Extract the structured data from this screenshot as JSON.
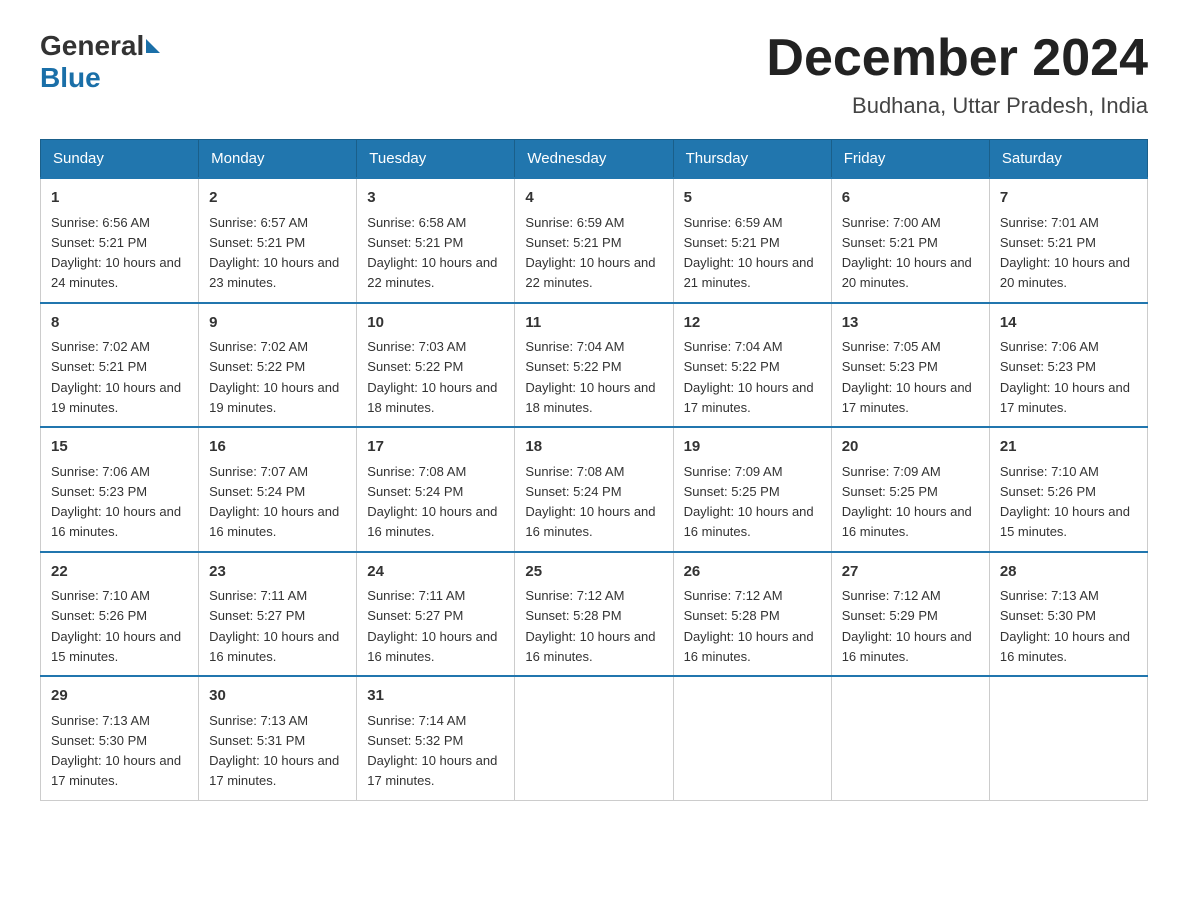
{
  "header": {
    "logo_general": "General",
    "logo_blue": "Blue",
    "month_title": "December 2024",
    "location": "Budhana, Uttar Pradesh, India"
  },
  "days_of_week": [
    "Sunday",
    "Monday",
    "Tuesday",
    "Wednesday",
    "Thursday",
    "Friday",
    "Saturday"
  ],
  "weeks": [
    [
      {
        "day": "1",
        "sunrise": "6:56 AM",
        "sunset": "5:21 PM",
        "daylight": "10 hours and 24 minutes."
      },
      {
        "day": "2",
        "sunrise": "6:57 AM",
        "sunset": "5:21 PM",
        "daylight": "10 hours and 23 minutes."
      },
      {
        "day": "3",
        "sunrise": "6:58 AM",
        "sunset": "5:21 PM",
        "daylight": "10 hours and 22 minutes."
      },
      {
        "day": "4",
        "sunrise": "6:59 AM",
        "sunset": "5:21 PM",
        "daylight": "10 hours and 22 minutes."
      },
      {
        "day": "5",
        "sunrise": "6:59 AM",
        "sunset": "5:21 PM",
        "daylight": "10 hours and 21 minutes."
      },
      {
        "day": "6",
        "sunrise": "7:00 AM",
        "sunset": "5:21 PM",
        "daylight": "10 hours and 20 minutes."
      },
      {
        "day": "7",
        "sunrise": "7:01 AM",
        "sunset": "5:21 PM",
        "daylight": "10 hours and 20 minutes."
      }
    ],
    [
      {
        "day": "8",
        "sunrise": "7:02 AM",
        "sunset": "5:21 PM",
        "daylight": "10 hours and 19 minutes."
      },
      {
        "day": "9",
        "sunrise": "7:02 AM",
        "sunset": "5:22 PM",
        "daylight": "10 hours and 19 minutes."
      },
      {
        "day": "10",
        "sunrise": "7:03 AM",
        "sunset": "5:22 PM",
        "daylight": "10 hours and 18 minutes."
      },
      {
        "day": "11",
        "sunrise": "7:04 AM",
        "sunset": "5:22 PM",
        "daylight": "10 hours and 18 minutes."
      },
      {
        "day": "12",
        "sunrise": "7:04 AM",
        "sunset": "5:22 PM",
        "daylight": "10 hours and 17 minutes."
      },
      {
        "day": "13",
        "sunrise": "7:05 AM",
        "sunset": "5:23 PM",
        "daylight": "10 hours and 17 minutes."
      },
      {
        "day": "14",
        "sunrise": "7:06 AM",
        "sunset": "5:23 PM",
        "daylight": "10 hours and 17 minutes."
      }
    ],
    [
      {
        "day": "15",
        "sunrise": "7:06 AM",
        "sunset": "5:23 PM",
        "daylight": "10 hours and 16 minutes."
      },
      {
        "day": "16",
        "sunrise": "7:07 AM",
        "sunset": "5:24 PM",
        "daylight": "10 hours and 16 minutes."
      },
      {
        "day": "17",
        "sunrise": "7:08 AM",
        "sunset": "5:24 PM",
        "daylight": "10 hours and 16 minutes."
      },
      {
        "day": "18",
        "sunrise": "7:08 AM",
        "sunset": "5:24 PM",
        "daylight": "10 hours and 16 minutes."
      },
      {
        "day": "19",
        "sunrise": "7:09 AM",
        "sunset": "5:25 PM",
        "daylight": "10 hours and 16 minutes."
      },
      {
        "day": "20",
        "sunrise": "7:09 AM",
        "sunset": "5:25 PM",
        "daylight": "10 hours and 16 minutes."
      },
      {
        "day": "21",
        "sunrise": "7:10 AM",
        "sunset": "5:26 PM",
        "daylight": "10 hours and 15 minutes."
      }
    ],
    [
      {
        "day": "22",
        "sunrise": "7:10 AM",
        "sunset": "5:26 PM",
        "daylight": "10 hours and 15 minutes."
      },
      {
        "day": "23",
        "sunrise": "7:11 AM",
        "sunset": "5:27 PM",
        "daylight": "10 hours and 16 minutes."
      },
      {
        "day": "24",
        "sunrise": "7:11 AM",
        "sunset": "5:27 PM",
        "daylight": "10 hours and 16 minutes."
      },
      {
        "day": "25",
        "sunrise": "7:12 AM",
        "sunset": "5:28 PM",
        "daylight": "10 hours and 16 minutes."
      },
      {
        "day": "26",
        "sunrise": "7:12 AM",
        "sunset": "5:28 PM",
        "daylight": "10 hours and 16 minutes."
      },
      {
        "day": "27",
        "sunrise": "7:12 AM",
        "sunset": "5:29 PM",
        "daylight": "10 hours and 16 minutes."
      },
      {
        "day": "28",
        "sunrise": "7:13 AM",
        "sunset": "5:30 PM",
        "daylight": "10 hours and 16 minutes."
      }
    ],
    [
      {
        "day": "29",
        "sunrise": "7:13 AM",
        "sunset": "5:30 PM",
        "daylight": "10 hours and 17 minutes."
      },
      {
        "day": "30",
        "sunrise": "7:13 AM",
        "sunset": "5:31 PM",
        "daylight": "10 hours and 17 minutes."
      },
      {
        "day": "31",
        "sunrise": "7:14 AM",
        "sunset": "5:32 PM",
        "daylight": "10 hours and 17 minutes."
      },
      null,
      null,
      null,
      null
    ]
  ],
  "labels": {
    "sunrise_prefix": "Sunrise: ",
    "sunset_prefix": "Sunset: ",
    "daylight_prefix": "Daylight: "
  }
}
